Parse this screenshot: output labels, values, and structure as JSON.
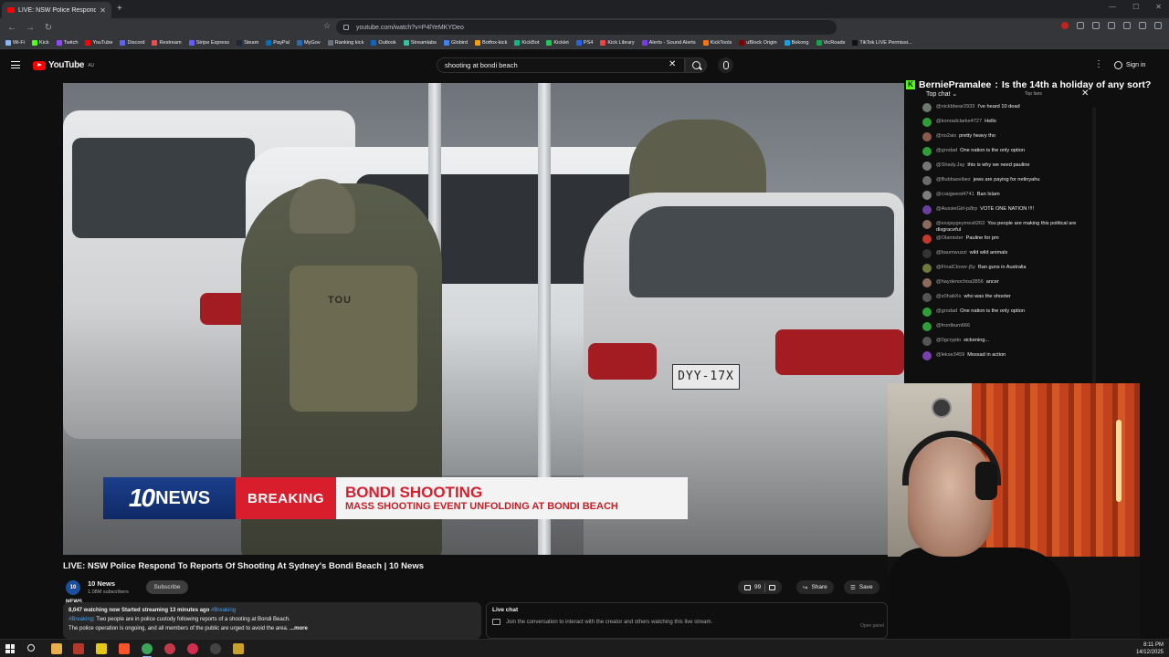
{
  "browser": {
    "tab_title": "LIVE: NSW Police Respond To",
    "url": "youtube.com/watch?v=P4lYeMKYDeo",
    "bookmarks": [
      "Wi-Fi",
      "Kick",
      "Twitch",
      "YouTube",
      "Discord",
      "Restream",
      "Stripe Express",
      "Steam",
      "PayPal",
      "MyGov",
      "Ranking kick",
      "Outlook",
      "Streamlabs",
      "Globird",
      "Botfox-kick",
      "KickBot",
      "Kicklet",
      "PS4",
      "Kick Library",
      "Alerts - Sound Alerts",
      "KickTools",
      "uBlock Origin",
      "Bekong",
      "VicRoads",
      "TikTok LIVE Permissi..."
    ]
  },
  "youtube": {
    "logo_text": "YouTube",
    "region": "AU",
    "search_value": "shooting at bondi beach",
    "signin_label": "Sign in"
  },
  "video": {
    "plate_text": "DYY-17X",
    "vest_label": "TOU",
    "lower_third": {
      "logo_number": "10",
      "logo_word": "NEWS",
      "breaking": "BREAKING",
      "headline": "BONDI SHOOTING",
      "subline": "MASS SHOOTING EVENT UNFOLDING AT BONDI BEACH"
    },
    "title": "LIVE: NSW Police Respond To Reports Of Shooting At Sydney's Bondi Beach | 10 News"
  },
  "channel": {
    "avatar_text": "10 NEWS",
    "name": "10 News",
    "subscribers": "1.08M subscribers",
    "subscribe_label": "Subscribe"
  },
  "actions": {
    "likes": "99",
    "share_label": "Share",
    "save_label": "Save"
  },
  "description": {
    "meta": "8,047 watching now  Started streaming 13 minutes ago",
    "meta_tag": "#Breaking",
    "tag": "#Breaking",
    "line1": ": Two people are in police custody following reports of a shooting at Bondi Beach.",
    "line2": "The police operation is ongoing, and all members of the public are urged to avoid the area.",
    "more": "...more"
  },
  "livechat_panel": {
    "title": "Live chat",
    "message": "Join the conversation to interact with the creator and others watching this live stream.",
    "open_panel": "Open panel"
  },
  "chat_overlay": {
    "banner_user": "BerniePramalee",
    "banner_message": "Is the 14th a holiday of any sort?",
    "mode": "Top chat",
    "top_fans": "Top fans",
    "messages": [
      {
        "user": "@nickbbear2933",
        "text": "I've heard 10 dead",
        "color": "#6b7a6b"
      },
      {
        "user": "@konradclarke4727",
        "text": "Hello",
        "color": "#2e9e3a"
      },
      {
        "user": "@no2ais",
        "text": "pretty heavy tho",
        "color": "#8b5a4a"
      },
      {
        "user": "@grodad",
        "text": "One nation is the only option",
        "color": "#2e9e3a"
      },
      {
        "user": "@Shady.Jay",
        "text": "this is why we need pauline",
        "color": "#777777"
      },
      {
        "user": "@Bubbasvibez",
        "text": "jews are paying for netinyahu",
        "color": "#6a6a6a"
      },
      {
        "user": "@craigwest4741",
        "text": "Ban Islam",
        "color": "#7d7d7d"
      },
      {
        "user": "@AussieGirl-js8rp",
        "text": "VOTE ONE NATION !!!!",
        "color": "#6b3fa0"
      },
      {
        "user": "@essjaygeymeslt263",
        "text": "You people are making this political are disgraceful",
        "color": "#8a6a5a"
      },
      {
        "user": "@Olamister",
        "text": "Pauline for pm",
        "color": "#c0392b"
      },
      {
        "user": "@baumwuzzi",
        "text": "wild wild animals",
        "color": "#333333"
      },
      {
        "user": "@FinalClover-j5y",
        "text": "Ban guns in Australia",
        "color": "#6c7a3a"
      },
      {
        "user": "@haydenochoa3856",
        "text": "ancer",
        "color": "#8b6a5a"
      },
      {
        "user": "@x0habXx",
        "text": "who was the shooter",
        "color": "#555555"
      },
      {
        "user": "@grodad",
        "text": "One nation is the only option",
        "color": "#2e9e3a"
      },
      {
        "user": "@frontbum666",
        "text": "",
        "color": "#2e9e3a"
      },
      {
        "user": "@0gcrypto",
        "text": "sickening...",
        "color": "#555555"
      },
      {
        "user": "@lekse3459",
        "text": "Mossad in action",
        "color": "#7b3fb0"
      }
    ]
  },
  "taskbar": {
    "time": "8:11 PM",
    "date": "14/12/2025"
  }
}
